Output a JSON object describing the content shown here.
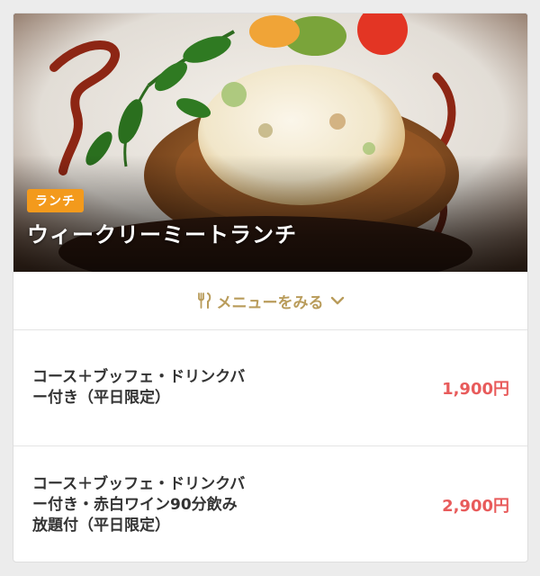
{
  "hero": {
    "badge": "ランチ",
    "title": "ウィークリーミートランチ"
  },
  "menu_toggle": {
    "label": "メニューをみる",
    "icon": "fork-knife-icon",
    "chevron": "chevron-down-icon"
  },
  "plans": [
    {
      "name": "コース＋ブッフェ・ドリンクバー付き（平日限定）",
      "price": "1,900円"
    },
    {
      "name": "コース＋ブッフェ・ドリンクバー付き・赤白ワイン90分飲み放題付（平日限定）",
      "price": "2,900円"
    }
  ],
  "colors": {
    "badge": "#f39a1c",
    "accent_gold": "#b99c5b",
    "price_red": "#e85b5b"
  }
}
